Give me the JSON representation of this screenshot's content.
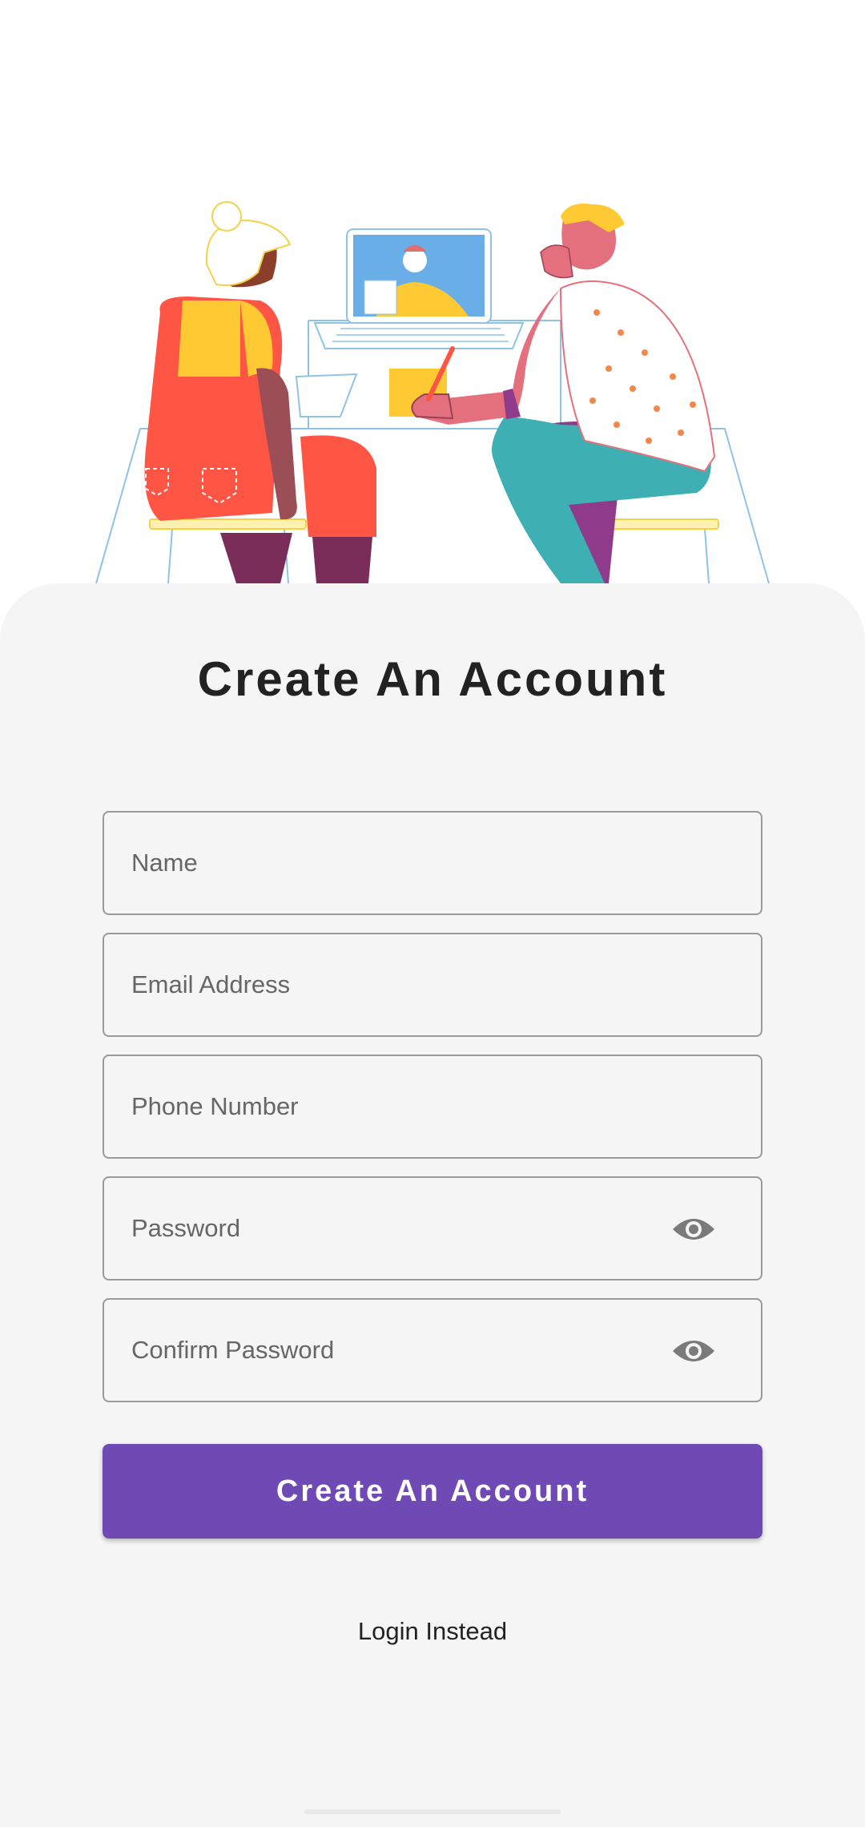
{
  "signup": {
    "title": "Create An Account",
    "fields": [
      {
        "placeholder": "Name",
        "value": ""
      },
      {
        "placeholder": "Email Address",
        "value": ""
      },
      {
        "placeholder": "Phone Number",
        "value": ""
      },
      {
        "placeholder": "Password",
        "value": "",
        "icon": "eye-icon"
      },
      {
        "placeholder": "Confirm Password",
        "value": "",
        "icon": "eye-icon"
      }
    ],
    "submit_label": "Create An Account",
    "login_label": "Login Instead"
  },
  "colors": {
    "accent": "#6f4ab5",
    "sheet_background": "#f5f5f5",
    "field_border": "#9a9a9a",
    "title_text": "#222222"
  }
}
